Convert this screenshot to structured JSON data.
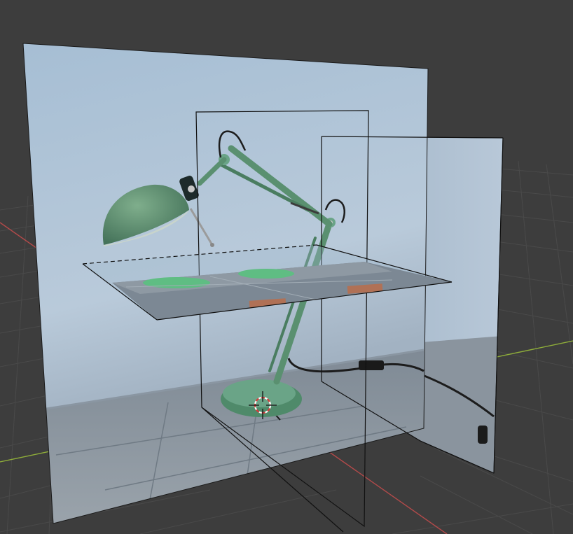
{
  "viewport": {
    "kind": "3d-viewport",
    "background_color": "#3d3d3d",
    "grid_line_color": "#4a4a4a",
    "x_axis_color": "#b34a4a",
    "y_axis_color": "#8fae3a"
  },
  "scene": {
    "subject": "green-desk-lamp",
    "planes": [
      {
        "id": "image-plane-back",
        "texture": "white-wall-and-floor-with-lamp"
      },
      {
        "id": "image-plane-right",
        "texture": "wall-corner-with-cable"
      },
      {
        "id": "image-plane-floor",
        "texture": "top-down-floor-view"
      },
      {
        "id": "wire-plane-center",
        "texture": "none"
      },
      {
        "id": "wire-plane-right",
        "texture": "none"
      }
    ],
    "cursor_icon": "3d-cursor-icon"
  }
}
